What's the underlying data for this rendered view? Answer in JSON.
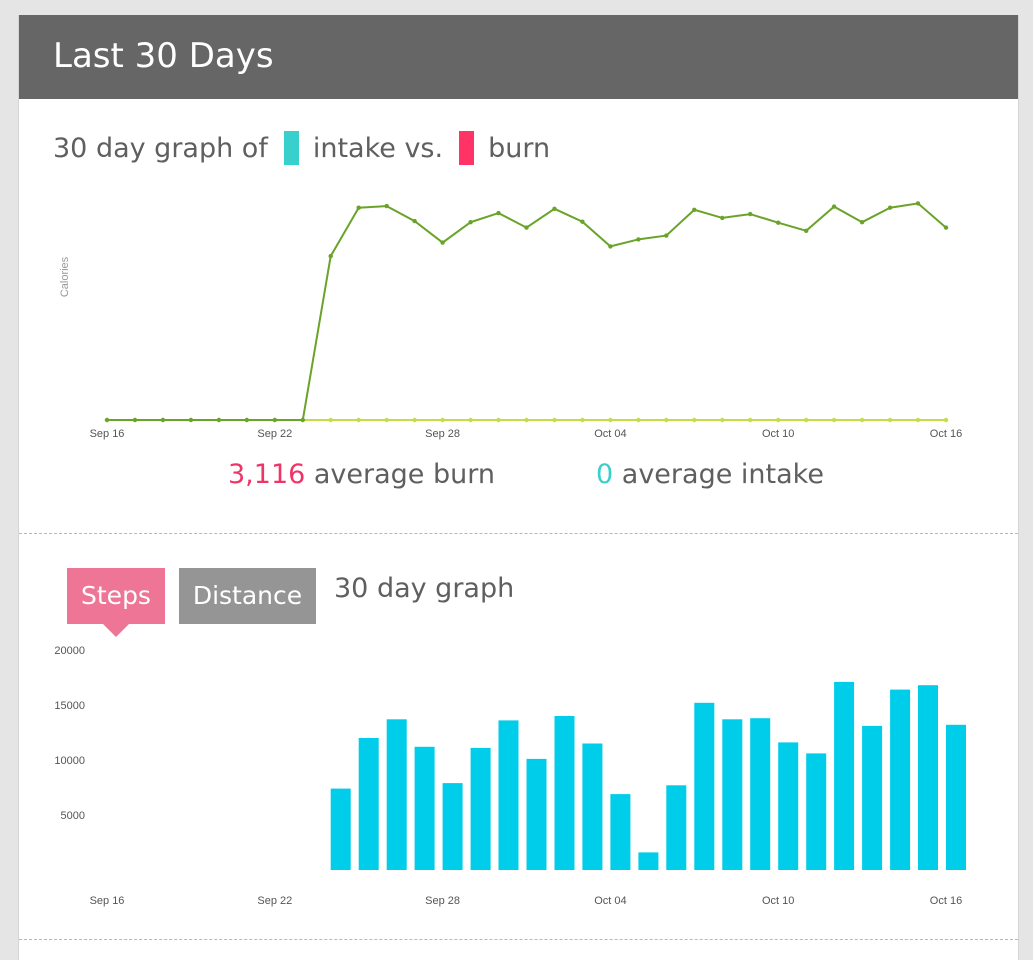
{
  "header": {
    "title": "Last 30 Days"
  },
  "calories": {
    "heading_prefix": "30 day graph of",
    "intake_word": "intake vs.",
    "burn_word": "burn",
    "avg_burn_value": "3,116",
    "avg_burn_label": "average burn",
    "avg_intake_value": "0",
    "avg_intake_label": "average intake"
  },
  "steps": {
    "tab_steps": "Steps",
    "tab_distance": "Distance",
    "heading": "30 day graph"
  },
  "colors": {
    "header_bg": "#666666",
    "intake": "#37d0cc",
    "burn": "#ff3366",
    "burn_number": "#ef3567",
    "burn_line": "#6aa329",
    "intake_line": "#c3de45",
    "steps_bar": "#00cdea",
    "steps_tab": "#ef7597",
    "distance_tab": "#959595"
  },
  "chart_data": [
    {
      "type": "line",
      "title": "",
      "xlabel": "",
      "ylabel": "Calories",
      "x_tick_labels": [
        "Sep 16",
        "Sep 22",
        "Sep 28",
        "Oct 04",
        "Oct 10",
        "Oct 16"
      ],
      "x": [
        "Sep 16",
        "Sep 17",
        "Sep 18",
        "Sep 19",
        "Sep 20",
        "Sep 21",
        "Sep 22",
        "Sep 23",
        "Sep 24",
        "Sep 25",
        "Sep 26",
        "Sep 27",
        "Sep 28",
        "Sep 29",
        "Sep 30",
        "Oct 01",
        "Oct 02",
        "Oct 03",
        "Oct 04",
        "Oct 05",
        "Oct 06",
        "Oct 07",
        "Oct 08",
        "Oct 09",
        "Oct 10",
        "Oct 11",
        "Oct 12",
        "Oct 13",
        "Oct 14",
        "Oct 15",
        "Oct 16"
      ],
      "ylim": [
        0,
        4000
      ],
      "grid": false,
      "series": [
        {
          "name": "burn",
          "color": "#6aa329",
          "values": [
            0,
            0,
            0,
            0,
            0,
            0,
            0,
            0,
            3050,
            3950,
            3980,
            3700,
            3300,
            3680,
            3850,
            3580,
            3930,
            3690,
            3230,
            3360,
            3430,
            3910,
            3760,
            3830,
            3670,
            3520,
            3970,
            3680,
            3950,
            4030,
            3580
          ]
        },
        {
          "name": "intake",
          "color": "#c3de45",
          "values": [
            0,
            0,
            0,
            0,
            0,
            0,
            0,
            0,
            0,
            0,
            0,
            0,
            0,
            0,
            0,
            0,
            0,
            0,
            0,
            0,
            0,
            0,
            0,
            0,
            0,
            0,
            0,
            0,
            0,
            0,
            0
          ]
        }
      ]
    },
    {
      "type": "bar",
      "title": "",
      "xlabel": "",
      "ylabel": "",
      "x_tick_labels": [
        "Sep 16",
        "Sep 22",
        "Sep 28",
        "Oct 04",
        "Oct 10",
        "Oct 16"
      ],
      "y_tick_labels": [
        "5000",
        "10000",
        "15000",
        "20000"
      ],
      "ylim": [
        0,
        20000
      ],
      "grid": false,
      "categories": [
        "Sep 16",
        "Sep 17",
        "Sep 18",
        "Sep 19",
        "Sep 20",
        "Sep 21",
        "Sep 22",
        "Sep 23",
        "Sep 24",
        "Sep 25",
        "Sep 26",
        "Sep 27",
        "Sep 28",
        "Sep 29",
        "Sep 30",
        "Oct 01",
        "Oct 02",
        "Oct 03",
        "Oct 04",
        "Oct 05",
        "Oct 06",
        "Oct 07",
        "Oct 08",
        "Oct 09",
        "Oct 10",
        "Oct 11",
        "Oct 12",
        "Oct 13",
        "Oct 14",
        "Oct 15",
        "Oct 16"
      ],
      "series": [
        {
          "name": "Steps",
          "color": "#00cdea",
          "values": [
            0,
            0,
            0,
            0,
            0,
            0,
            0,
            0,
            7400,
            12000,
            13700,
            11200,
            7900,
            11100,
            13600,
            10100,
            14000,
            11500,
            6900,
            1600,
            7700,
            15200,
            13700,
            13800,
            11600,
            10600,
            17100,
            13100,
            16400,
            16800,
            13200
          ]
        }
      ]
    }
  ]
}
